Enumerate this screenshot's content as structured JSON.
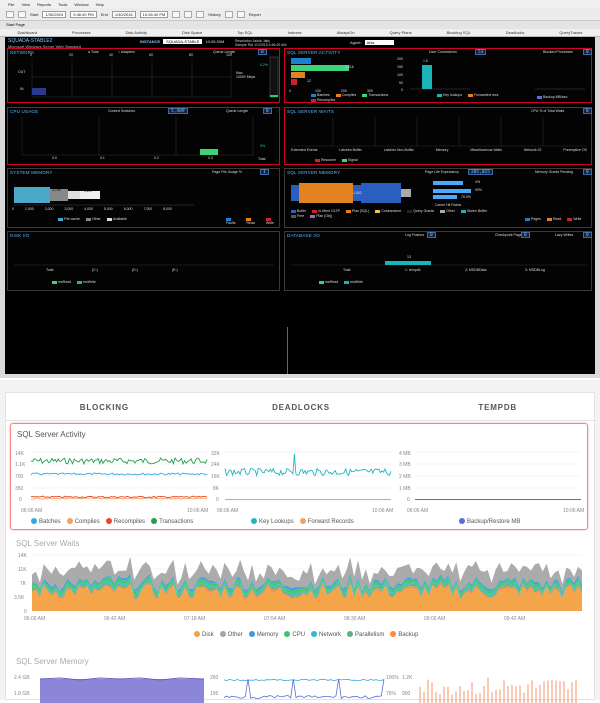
{
  "top": {
    "menu": [
      "File",
      "View",
      "Reports",
      "Tools",
      "Window",
      "Help"
    ],
    "toolbar": {
      "start_label": "Start",
      "start_date": "1/30/2015",
      "start_time": "9:46:40 PM",
      "end_label": "End",
      "end_date": "1/30/2015",
      "end_time": "10:26:40 PM",
      "history_label": "History",
      "report_label": "Report",
      "start_page_label": "Start Page"
    },
    "tabs": [
      "Dashboard",
      "Processes",
      "Disk Activity",
      "Disk Space",
      "Top SQL",
      "Indexes",
      "AlwaysOn",
      "Query Plans",
      "Blocking SQL",
      "Deadlocks",
      "QueryTraces"
    ],
    "header": {
      "title": "SQUADA-STABLE2",
      "subtitle": "Microsoft Windows Server Web Standard",
      "instance_label": "INSTANCE",
      "instance_value": "SQUADA-STABLE",
      "instance_time": "10:06:30M",
      "res_label": "Resolution",
      "res_value": "Jakub Jaky",
      "sample_label": "Sample Rst",
      "sample_value": "1/1/2015 4:46:29 AM",
      "agent_label": "Agent:",
      "agent_value": "Ahis"
    },
    "network": {
      "title": "NETWORK",
      "opt_total": "Total",
      "opt_adapters": "Adapters",
      "queue_label": "Queue Length",
      "queue_value": "0",
      "in_label": "IN",
      "out_label": "OUT",
      "x_ticks": [
        "0",
        "20",
        "40",
        "60",
        "80",
        "100"
      ],
      "max_label": "Max",
      "max_value": "10000 Mbps",
      "pct_label": "0.2%"
    },
    "cpu": {
      "title": "CPU USAGE",
      "ctx_label": "Context Switches",
      "ctx_value": "5,409",
      "queue_label": "Queue Length",
      "queue_value": "0",
      "ticks": [
        "0.0",
        "0.1",
        "0.2",
        "0.3"
      ],
      "total_label": "Total",
      "pct_label": "0%"
    },
    "sysmem": {
      "title": "SYSTEM MEMORY",
      "pfu_label": "Page File Usage %",
      "pfu_value": "1",
      "x_ticks": [
        "0",
        "1,000",
        "2,000",
        "3,000",
        "4,000",
        "5,000",
        "6,000",
        "7,000",
        "8,000"
      ],
      "bar_values": [
        "3,780",
        "1,217"
      ],
      "legend": [
        "File cache",
        "Other",
        "Available"
      ],
      "paging_legend": [
        "Faults",
        "Read",
        "Write"
      ]
    },
    "disk_io": {
      "title": "DISK I/O",
      "rows": [
        "Total",
        "(C:)",
        "(D:)",
        "(E:)"
      ],
      "legend": [
        "msRead",
        "msWrite"
      ]
    },
    "activity": {
      "title": "SQL SERVER ACTIVITY",
      "user_conn_label": "User Connections",
      "user_conn_value": "53",
      "blocked_label": "Blocked Processes",
      "blocked_value": "0",
      "bar_values": [
        "1,016",
        "12"
      ],
      "ticks": [
        "0",
        "100",
        "200",
        "300"
      ],
      "legend": [
        "Batches",
        "Compiles",
        "Transactions",
        "Recompiles"
      ],
      "mid_value": "1.8",
      "mid_ticks": [
        "200",
        "150",
        "100",
        "50",
        "0"
      ],
      "mid_legend": [
        "Key lookups",
        "Forwarded recs"
      ],
      "right_legend": [
        "Backup MB/sec"
      ]
    },
    "waits": {
      "title": "SQL SERVER WAITS",
      "cpu_label": "CPU % of Total Waits",
      "cpu_value": "0",
      "categories": [
        "Extended Events",
        "Latches Buffer",
        "Latches Non-Buffer",
        "Memory",
        "Miscellaneous Waits",
        "Network IO",
        "Preemptive OS"
      ],
      "legend": [
        "Resource",
        "Signal"
      ]
    },
    "sqlmem": {
      "title": "SQL SERVER MEMORY",
      "ple_label": "Page Life Expectancy",
      "ple_value": "205,015",
      "mgp_label": "Memory Grants Pending",
      "mgp_value": "0",
      "bar_values": [
        "1,802",
        "4%",
        "99%",
        "75.0%"
      ],
      "cache_label": "Cache Hit Ratios",
      "legend": [
        "Buffer",
        "In-Mem OLTP",
        "Plan (SQL)",
        "Columnstore",
        "Query Grants",
        "Other",
        "Stolen Buffer",
        "Free",
        "Plan (Obj)"
      ],
      "pages_legend": [
        "Pages",
        "Read",
        "Write"
      ]
    },
    "db_io": {
      "title": "DATABASE I/O",
      "log_label": "Log Flushes",
      "log_value": "0",
      "ckpt_label": "Checkpoint Pages",
      "ckpt_value": "0",
      "lazy_label": "Lazy Writes",
      "lazy_value": "0",
      "rows": [
        "Total",
        "1: tempdb",
        "2: MSDBData",
        "3: MSDBLog"
      ],
      "values": [
        "13"
      ],
      "legend": [
        "msRead",
        "msWrite"
      ]
    }
  },
  "bottom": {
    "tabs": [
      "BLOCKING",
      "DEADLOCKS",
      "TEMPDB"
    ],
    "activity": {
      "title": "SQL Server Activity",
      "chart1": {
        "y_ticks": [
          "14K",
          "1.1K",
          "700",
          "350",
          "0"
        ],
        "x_ticks": [
          "06:06 AM",
          "10:06 AM"
        ],
        "legend": [
          "Batches",
          "Compiles",
          "Recompiles",
          "Transactions"
        ]
      },
      "chart2": {
        "y_ticks": [
          "32K",
          "24K",
          "16K",
          "8K",
          "0"
        ],
        "x_ticks": [
          "06:06 AM",
          "10:06 AM"
        ],
        "legend": [
          "Key Lookups",
          "Forward Records"
        ]
      },
      "chart3": {
        "y_ticks": [
          "4 MB",
          "3 MB",
          "2 MB",
          "1 MB",
          "0"
        ],
        "x_ticks": [
          "06:06 AM",
          "10:06 AM"
        ],
        "legend": [
          "Backup/Restore MB"
        ]
      }
    },
    "waits": {
      "title": "SQL Server Waits",
      "y_ticks": [
        "14K",
        "11K",
        "7K",
        "3.5K",
        "0"
      ],
      "x_ticks": [
        "06:06 AM",
        "06:42 AM",
        "07:18 AM",
        "07:54 AM",
        "08:30 AM",
        "09:06 AM",
        "09:42 AM"
      ],
      "legend": [
        "Disk",
        "Other",
        "Memory",
        "CPU",
        "Network",
        "Parallelism",
        "Backup"
      ]
    },
    "memory": {
      "title": "SQL Server Memory",
      "chart1": {
        "y_ticks": [
          "2.4 GB",
          "1.8 GB"
        ]
      },
      "chart2": {
        "y_ticks": [
          "260",
          "195"
        ],
        "right_ticks": [
          "100%",
          "75%"
        ]
      },
      "chart3": {
        "y_ticks": [
          "1.2K",
          "900"
        ]
      }
    }
  },
  "colors": {
    "batches": "#3aa6dd",
    "compiles": "#f4a15d",
    "recompiles": "#e8452c",
    "transactions": "#22a04a",
    "key_lookups": "#21b6c2",
    "forward_records": "#f4a15d",
    "backup": "#5a6fd1",
    "disk": "#f3a03f",
    "other": "#a6a6a6",
    "memory": "#3f9ad8",
    "cpu": "#3dc468",
    "network": "#36b9c9",
    "parallelism": "#5bb27e",
    "backup_wait": "#ff8a3d"
  }
}
